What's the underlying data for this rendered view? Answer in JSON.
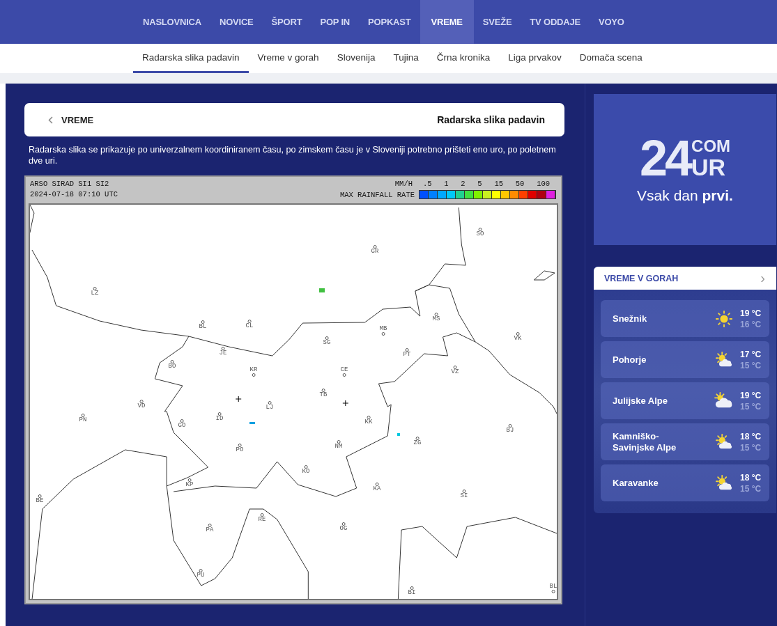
{
  "main_nav": [
    {
      "label": "NASLOVNICA",
      "selected": false
    },
    {
      "label": "NOVICE",
      "selected": false
    },
    {
      "label": "ŠPORT",
      "selected": false
    },
    {
      "label": "POP IN",
      "selected": false
    },
    {
      "label": "POPKAST",
      "selected": false
    },
    {
      "label": "VREME",
      "selected": true
    },
    {
      "label": "SVEŽE",
      "selected": false
    },
    {
      "label": "TV ODDAJE",
      "selected": false
    },
    {
      "label": "VOYO",
      "selected": false
    }
  ],
  "sub_nav": [
    {
      "label": "Radarska slika padavin",
      "selected": true
    },
    {
      "label": "Vreme v gorah",
      "selected": false
    },
    {
      "label": "Slovenija",
      "selected": false
    },
    {
      "label": "Tujina",
      "selected": false
    },
    {
      "label": "Črna kronika",
      "selected": false
    },
    {
      "label": "Liga prvakov",
      "selected": false
    },
    {
      "label": "Domača scena",
      "selected": false
    }
  ],
  "page_header": {
    "back_label": "VREME",
    "title": "Radarska slika padavin"
  },
  "description": "Radarska slika se prikazuje po univerzalnem koordiniranem času, po zimskem času je v Sloveniji potrebno prišteti eno uro, po poletnem dve uri.",
  "radar": {
    "source": "ARSO SIRAD SI1 SI2",
    "timestamp": "2024-07-18 07:10 UTC",
    "unit": "MM/H",
    "legend_title": "MAX RAINFALL RATE",
    "legend_labels": [
      ".5",
      "1",
      "2",
      "5",
      "15",
      "50",
      "100"
    ],
    "swatches": [
      {
        "color": "#0050ff"
      },
      {
        "color": "#0080ff"
      },
      {
        "color": "#00a8ff"
      },
      {
        "color": "#00c8f8"
      },
      {
        "color": "#20d090"
      },
      {
        "color": "#40e040"
      },
      {
        "color": "#80f000"
      },
      {
        "color": "#c8f020"
      },
      {
        "color": "#ffff00"
      },
      {
        "color": "#ffc800"
      },
      {
        "color": "#ff8c00"
      },
      {
        "color": "#ff4000"
      },
      {
        "color": "#e00000"
      },
      {
        "color": "#b00010"
      },
      {
        "color": "#e020e0"
      }
    ],
    "stations": [
      "LZ",
      "BL",
      "CL",
      "JE",
      "BO",
      "KR",
      "VD",
      "LJ",
      "ID",
      "GO",
      "PN",
      "PO",
      "KP",
      "BE",
      "GR",
      "SO",
      "MB",
      "SG",
      "MS",
      "PT",
      "CE",
      "TB",
      "VZ",
      "VK",
      "KK",
      "NM",
      "ZG",
      "BJ",
      "KO",
      "KA",
      "SI",
      "RE",
      "OG",
      "PA",
      "PU",
      "BI",
      "BL"
    ]
  },
  "promo": {
    "logo_number": "24",
    "logo_top": "COM",
    "logo_bottom": "UR",
    "tagline": "Vsak dan **prvi.**"
  },
  "mountain_weather": {
    "title": "VREME V GORAH",
    "chevron": "›",
    "locations": [
      {
        "name": "Snežnik",
        "kind": "sun",
        "high": "19 °C",
        "low": "16 °C"
      },
      {
        "name": "Pohorje",
        "kind": "sun-cloud",
        "high": "17 °C",
        "low": "15 °C"
      },
      {
        "name": "Julijske Alpe",
        "kind": "cloud-sun",
        "high": "19 °C",
        "low": "15 °C"
      },
      {
        "name": "Kamniško-Savinjske Alpe",
        "kind": "sun-cloud",
        "high": "18 °C",
        "low": "15 °C"
      },
      {
        "name": "Karavanke",
        "kind": "sun-cloud",
        "high": "18 °C",
        "low": "15 °C"
      }
    ]
  }
}
